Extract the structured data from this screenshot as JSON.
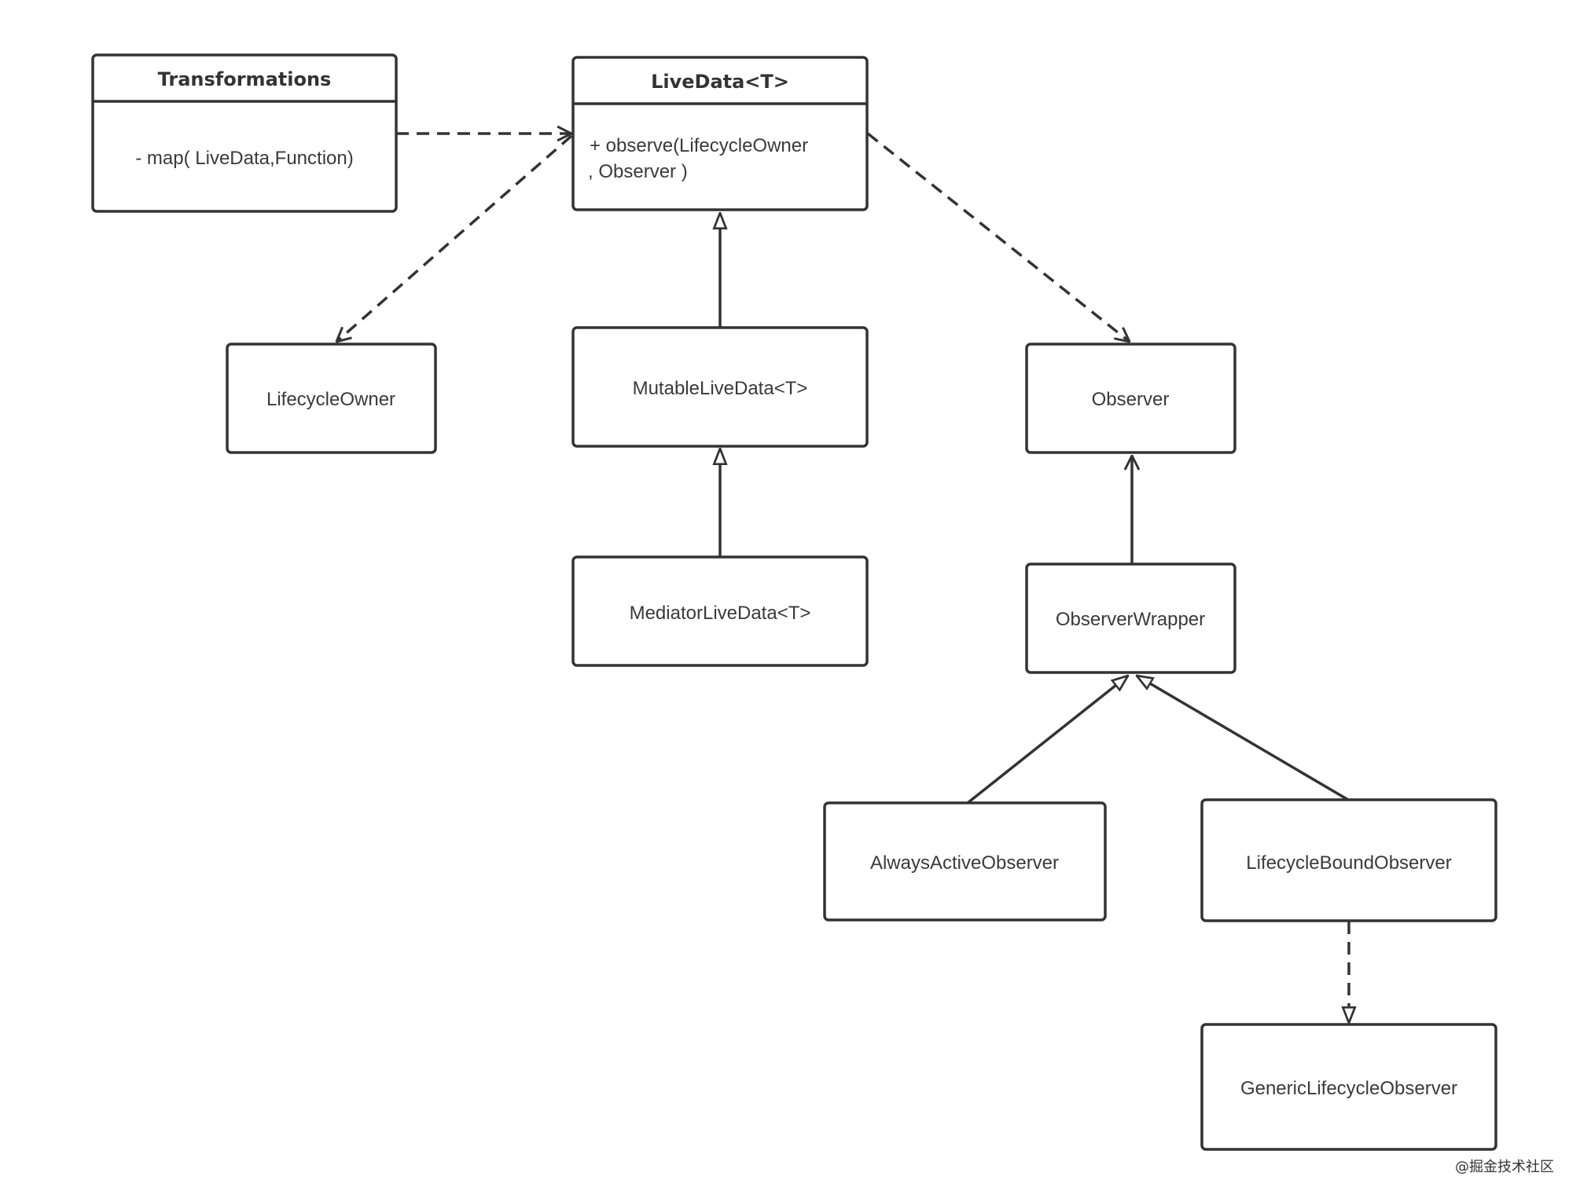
{
  "classes": {
    "transformations": {
      "name": "Transformations",
      "member": "- map( LiveData,Function)"
    },
    "livedata": {
      "name": "LiveData<T>",
      "member_line1": "+ observe(LifecycleOwner",
      "member_line2": ", Observer )"
    },
    "lifecycle_owner": {
      "name": "LifecycleOwner"
    },
    "mutable_livedata": {
      "name": "MutableLiveData<T>"
    },
    "mediator_livedata": {
      "name": "MediatorLiveData<T>"
    },
    "observer": {
      "name": "Observer"
    },
    "observer_wrapper": {
      "name": "ObserverWrapper"
    },
    "always_active_observer": {
      "name": "AlwaysActiveObserver"
    },
    "lifecycle_bound_observer": {
      "name": "LifecycleBoundObserver"
    },
    "generic_lifecycle_observer": {
      "name": "GenericLifecycleObserver"
    }
  },
  "relations": [
    {
      "from": "Transformations",
      "to": "LiveData<T>",
      "type": "dependency"
    },
    {
      "from": "LiveData<T>",
      "to": "LifecycleOwner",
      "type": "dependency"
    },
    {
      "from": "LiveData<T>",
      "to": "Observer",
      "type": "dependency"
    },
    {
      "from": "MutableLiveData<T>",
      "to": "LiveData<T>",
      "type": "generalization"
    },
    {
      "from": "MediatorLiveData<T>",
      "to": "MutableLiveData<T>",
      "type": "generalization"
    },
    {
      "from": "ObserverWrapper",
      "to": "Observer",
      "type": "association"
    },
    {
      "from": "AlwaysActiveObserver",
      "to": "ObserverWrapper",
      "type": "generalization"
    },
    {
      "from": "LifecycleBoundObserver",
      "to": "ObserverWrapper",
      "type": "generalization"
    },
    {
      "from": "LifecycleBoundObserver",
      "to": "GenericLifecycleObserver",
      "type": "realization"
    }
  ],
  "watermark": "@掘金技术社区",
  "colors": {
    "stroke": "#333333",
    "background": "#ffffff"
  }
}
